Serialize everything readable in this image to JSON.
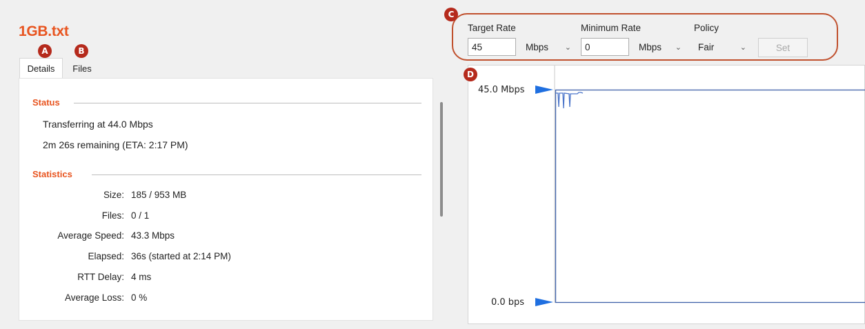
{
  "file": {
    "title": "1GB.txt"
  },
  "badges": {
    "a": "A",
    "b": "B",
    "c": "C",
    "d": "D"
  },
  "tabs": {
    "details": "Details",
    "files": "Files"
  },
  "status": {
    "heading": "Status",
    "transfer_line": "Transferring at 44.0 Mbps",
    "remaining_line": "2m 26s remaining (ETA: 2:17 PM)"
  },
  "statistics": {
    "heading": "Statistics",
    "rows": [
      {
        "label": "Size:",
        "value": "185 / 953 MB"
      },
      {
        "label": "Files:",
        "value": "0 / 1"
      },
      {
        "label": "Average Speed:",
        "value": "43.3 Mbps"
      },
      {
        "label": "Elapsed:",
        "value": "36s (started at 2:14 PM)"
      },
      {
        "label": "RTT Delay:",
        "value": "4 ms"
      },
      {
        "label": "Average Loss:",
        "value": "0 %"
      }
    ]
  },
  "rate_control": {
    "target_rate_label": "Target Rate",
    "target_rate_value": "45",
    "target_unit": "Mbps",
    "minimum_rate_label": "Minimum Rate",
    "minimum_rate_value": "0",
    "minimum_unit": "Mbps",
    "policy_label": "Policy",
    "policy_value": "Fair",
    "set_label": "Set"
  },
  "graph": {
    "top_label": "45.0 Mbps",
    "bottom_label": "0.0 bps",
    "marker_color": "#1f6fe0",
    "line_color": "#4a74c9"
  },
  "colors": {
    "accent": "#e8541f",
    "badge": "#b52a1c",
    "group_outline": "#c0502d"
  }
}
